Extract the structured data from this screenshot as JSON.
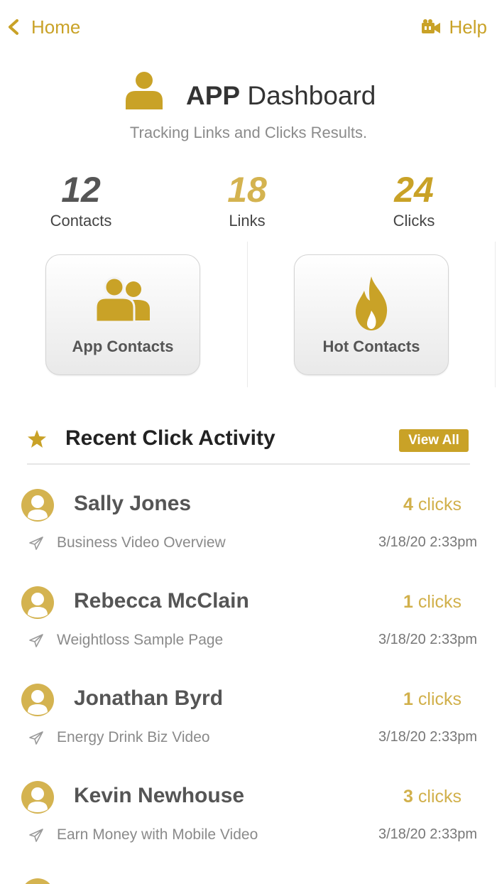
{
  "nav": {
    "back_label": "Home",
    "back_icon": "chevron-left-icon",
    "help_label": "Help",
    "help_icon": "video-camera-icon"
  },
  "header": {
    "title_bold": "APP",
    "title_rest": "Dashboard",
    "subtitle": "Tracking Links and Clicks Results.",
    "icon": "user-icon"
  },
  "stats": [
    {
      "value": "12",
      "label": "Contacts",
      "color": "#555555"
    },
    {
      "value": "18",
      "label": "Links",
      "color": "#d4b350"
    },
    {
      "value": "24",
      "label": "Clicks",
      "color": "#c9a227"
    }
  ],
  "tiles": [
    {
      "label": "App Contacts",
      "icon": "users-icon"
    },
    {
      "label": "Hot Contacts",
      "icon": "flame-icon"
    }
  ],
  "activity": {
    "title": "Recent Click Activity",
    "title_icon": "star-icon",
    "view_all_label": "View All",
    "items": [
      {
        "name": "Sally Jones",
        "count": "4",
        "count_suffix": "clicks",
        "link": "Business Video Overview",
        "date": "3/18/20 2:33pm"
      },
      {
        "name": "Rebecca McClain",
        "count": "1",
        "count_suffix": "clicks",
        "link": "Weightloss Sample Page",
        "date": "3/18/20 2:33pm"
      },
      {
        "name": "Jonathan Byrd",
        "count": "1",
        "count_suffix": "clicks",
        "link": "Energy Drink Biz Video",
        "date": "3/18/20 2:33pm"
      },
      {
        "name": "Kevin Newhouse",
        "count": "3",
        "count_suffix": "clicks",
        "link": "Earn Money with Mobile Video",
        "date": "3/18/20 2:33pm"
      }
    ]
  },
  "colors": {
    "accent": "#c9a227",
    "accent_light": "#d4b350",
    "text_dark": "#333333",
    "text_muted": "#8b8b8b"
  }
}
